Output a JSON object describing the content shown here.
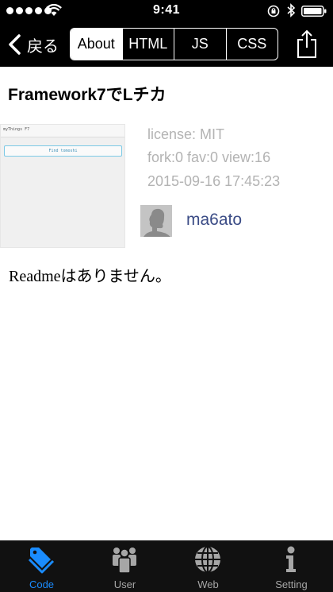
{
  "status_bar": {
    "time": "9:41"
  },
  "nav": {
    "back_label": "戻る",
    "segments": [
      "About",
      "HTML",
      "JS",
      "CSS"
    ],
    "active_segment": "About"
  },
  "repo": {
    "title": "Framework7でLチカ",
    "preview": {
      "app_title": "myThings F7",
      "button_label": "Find tomoshi"
    },
    "license": "license: MIT",
    "stats": "fork:0 fav:0 view:16",
    "date": "2015-09-16 17:45:23",
    "author": "ma6ato",
    "readme": "Readmeはありません。"
  },
  "tabbar": {
    "items": [
      {
        "label": "Code",
        "icon": "tags-icon",
        "active": true
      },
      {
        "label": "User",
        "icon": "users-icon",
        "active": false
      },
      {
        "label": "Web",
        "icon": "globe-icon",
        "active": false
      },
      {
        "label": "Setting",
        "icon": "info-icon",
        "active": false
      }
    ]
  },
  "colors": {
    "bar_background": "#000000",
    "tab_active": "#1a8cff",
    "tab_inactive": "#a6a6a6",
    "meta_text": "#b3b3b3",
    "author_link": "#3b4c86"
  }
}
